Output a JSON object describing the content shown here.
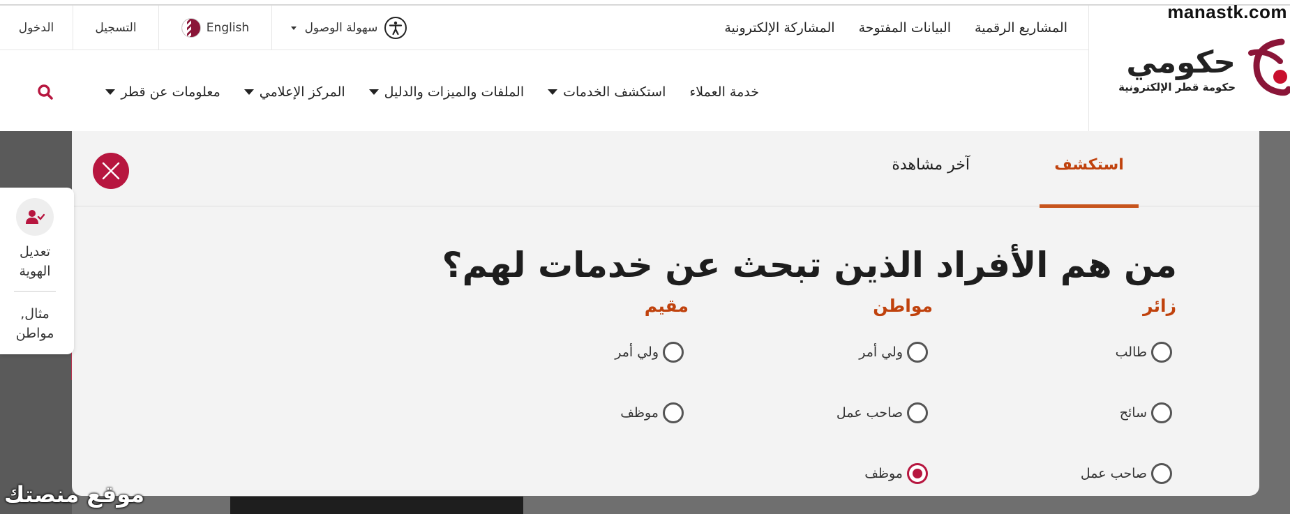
{
  "watermark": "manastk.com",
  "site_watermark": "موقع منصتك",
  "utility": {
    "login": "الدخول",
    "register": "التسجيل",
    "language": "English",
    "accessibility": "سهولة الوصول",
    "links": [
      "المشاريع الرقمية",
      "البيانات المفتوحة",
      "المشاركة الإلكترونية"
    ]
  },
  "logo": {
    "name": "حكومي",
    "subtitle": "حكومة قطر الإلكترونية"
  },
  "nav": [
    "خدمة العملاء",
    "استكشف الخدمات",
    "الملفات والميزات والدليل",
    "المركز الإعلامي",
    "معلومات عن قطر"
  ],
  "tabs": {
    "explore": "استكشف",
    "recent": "آخر مشاهدة"
  },
  "question": "من هم الأفراد الذين تبحث عن خدمات لهم؟",
  "groups": {
    "visitor": {
      "title": "زائر",
      "options": [
        "طالب",
        "سائح",
        "صاحب عمل"
      ]
    },
    "citizen": {
      "title": "مواطن",
      "options": [
        "ولي أمر",
        "صاحب عمل",
        "موظف"
      ],
      "selected": "موظف"
    },
    "resident": {
      "title": "مقيم",
      "options": [
        "ولي أمر",
        "موظف"
      ]
    }
  },
  "side_widget": {
    "edit_label_1": "تعديل",
    "edit_label_2": "الهوية",
    "example_1": "مثال,",
    "example_2": "مواطن"
  },
  "colors": {
    "brand": "#8a1538",
    "accent": "#b7163f",
    "tab_active": "#c0420d"
  }
}
